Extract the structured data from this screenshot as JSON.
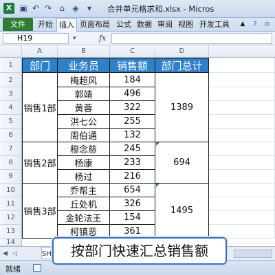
{
  "window": {
    "title": "合并单元格求和.xlsx - Micros"
  },
  "ribbon": {
    "tabs": [
      {
        "label": "文件"
      },
      {
        "label": "开始"
      },
      {
        "label": "插入"
      },
      {
        "label": "页面布局"
      },
      {
        "label": "公式"
      },
      {
        "label": "数据"
      },
      {
        "label": "审阅"
      },
      {
        "label": "视图"
      },
      {
        "label": "开发工具"
      }
    ],
    "active_tab": "插入"
  },
  "formula_bar": {
    "name_box": "H19",
    "fx": "fx",
    "formula": ""
  },
  "columns": [
    "A",
    "B",
    "C",
    "D"
  ],
  "rows": [
    "1",
    "2",
    "3",
    "4",
    "5",
    "6",
    "7",
    "8",
    "9",
    "10",
    "11",
    "12",
    "13",
    "14"
  ],
  "table": {
    "headers": [
      "部门",
      "业务员",
      "销售额",
      "部门总计"
    ],
    "groups": [
      {
        "dept": "销售1部",
        "total": "1389",
        "rows": [
          [
            "梅超风",
            "184"
          ],
          [
            "郭靖",
            "496"
          ],
          [
            "黄蓉",
            "322"
          ],
          [
            "洪七公",
            "255"
          ],
          [
            "周伯通",
            "132"
          ]
        ]
      },
      {
        "dept": "销售2部",
        "total": "694",
        "rows": [
          [
            "穆念慈",
            "245"
          ],
          [
            "杨康",
            "233"
          ],
          [
            "杨过",
            "216"
          ]
        ]
      },
      {
        "dept": "销售3部",
        "total": "1495",
        "rows": [
          [
            "乔帮主",
            "654"
          ],
          [
            "丘处机",
            "326"
          ],
          [
            "金轮法王",
            "154"
          ],
          [
            "柯镇恶",
            "361"
          ]
        ]
      }
    ]
  },
  "sheet_tab": "SH",
  "status": {
    "ready": "就绪"
  },
  "caption": "按部门快速汇总销售额",
  "colors": {
    "header_fill": "#2f80c8",
    "file_tab": "#2e7d32"
  }
}
